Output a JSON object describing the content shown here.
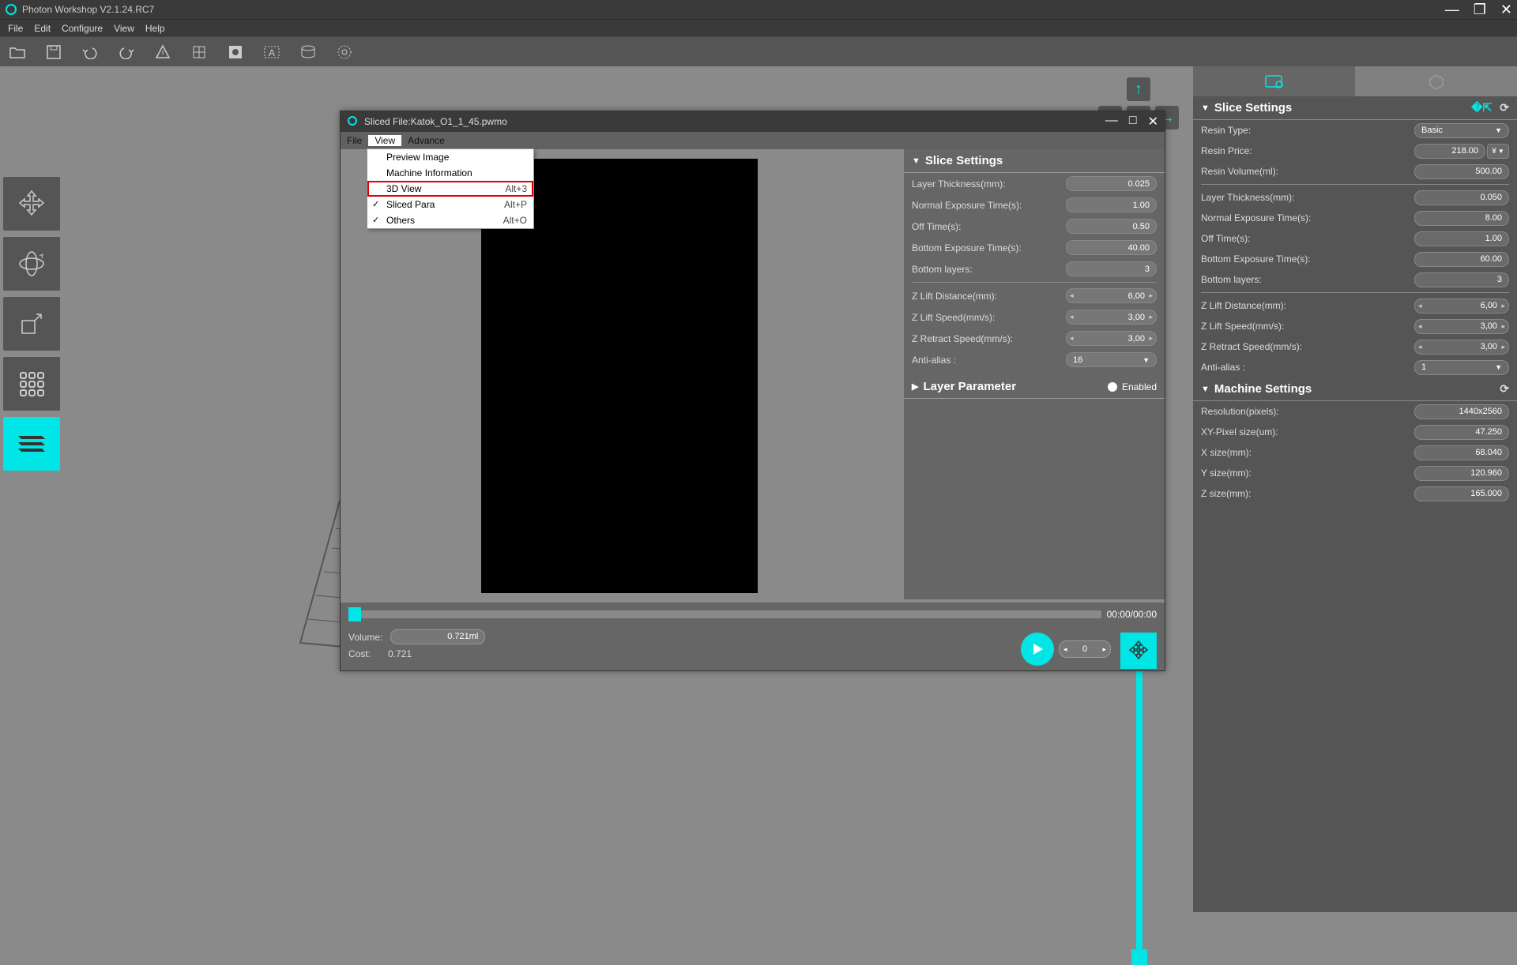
{
  "app": {
    "title": "Photon Workshop V2.1.24.RC7"
  },
  "menubar": {
    "file": "File",
    "edit": "Edit",
    "configure": "Configure",
    "view": "View",
    "help": "Help"
  },
  "dialog": {
    "title": "Sliced File:Katok_O1_1_45.pwmo",
    "menu": {
      "file": "File",
      "view": "View",
      "advance": "Advance"
    },
    "viewMenu": {
      "previewImage": "Preview Image",
      "machineInfo": "Machine Information",
      "view3d": "3D View",
      "view3dShortcut": "Alt+3",
      "slicedPara": "Sliced Para",
      "slicedParaShortcut": "Alt+P",
      "others": "Others",
      "othersShortcut": "Alt+O"
    },
    "sliceSettings": {
      "header": "Slice Settings",
      "layerThickness": {
        "label": "Layer Thickness(mm):",
        "value": "0.025"
      },
      "normalExposure": {
        "label": "Normal Exposure Time(s):",
        "value": "1.00"
      },
      "offTime": {
        "label": "Off Time(s):",
        "value": "0.50"
      },
      "bottomExposure": {
        "label": "Bottom Exposure Time(s):",
        "value": "40.00"
      },
      "bottomLayers": {
        "label": "Bottom layers:",
        "value": "3"
      },
      "zLiftDist": {
        "label": "Z Lift Distance(mm):",
        "value": "6,00"
      },
      "zLiftSpeed": {
        "label": "Z Lift Speed(mm/s):",
        "value": "3,00"
      },
      "zRetractSpeed": {
        "label": "Z Retract Speed(mm/s):",
        "value": "3,00"
      },
      "antiAlias": {
        "label": "Anti-alias :",
        "value": "16"
      }
    },
    "layerParam": {
      "header": "Layer Parameter",
      "enabled": "Enabled"
    },
    "bottom": {
      "time": "00:00/00:00",
      "volumeLabel": "Volume:",
      "volume": "0.721ml",
      "costLabel": "Cost:",
      "cost": "0.721",
      "frame": "0"
    }
  },
  "rightPanel": {
    "sliceSettings": {
      "header": "Slice Settings",
      "resinType": {
        "label": "Resin Type:",
        "value": "Basic"
      },
      "resinPrice": {
        "label": "Resin Price:",
        "value": "218.00",
        "unit": "¥"
      },
      "resinVolume": {
        "label": "Resin Volume(ml):",
        "value": "500.00"
      },
      "layerThickness": {
        "label": "Layer Thickness(mm):",
        "value": "0.050"
      },
      "normalExposure": {
        "label": "Normal Exposure Time(s):",
        "value": "8.00"
      },
      "offTime": {
        "label": "Off Time(s):",
        "value": "1.00"
      },
      "bottomExposure": {
        "label": "Bottom Exposure Time(s):",
        "value": "60.00"
      },
      "bottomLayers": {
        "label": "Bottom layers:",
        "value": "3"
      },
      "zLiftDist": {
        "label": "Z Lift Distance(mm):",
        "value": "6,00"
      },
      "zLiftSpeed": {
        "label": "Z Lift Speed(mm/s):",
        "value": "3,00"
      },
      "zRetractSpeed": {
        "label": "Z Retract Speed(mm/s):",
        "value": "3,00"
      },
      "antiAlias": {
        "label": "Anti-alias :",
        "value": "1"
      }
    },
    "machineSettings": {
      "header": "Machine Settings",
      "resolution": {
        "label": "Resolution(pixels):",
        "value": "1440x2560"
      },
      "xyPixel": {
        "label": "XY-Pixel size(um):",
        "value": "47.250"
      },
      "xSize": {
        "label": "X size(mm):",
        "value": "68.040"
      },
      "ySize": {
        "label": "Y size(mm):",
        "value": "120.960"
      },
      "zSize": {
        "label": "Z size(mm):",
        "value": "165.000"
      }
    }
  }
}
